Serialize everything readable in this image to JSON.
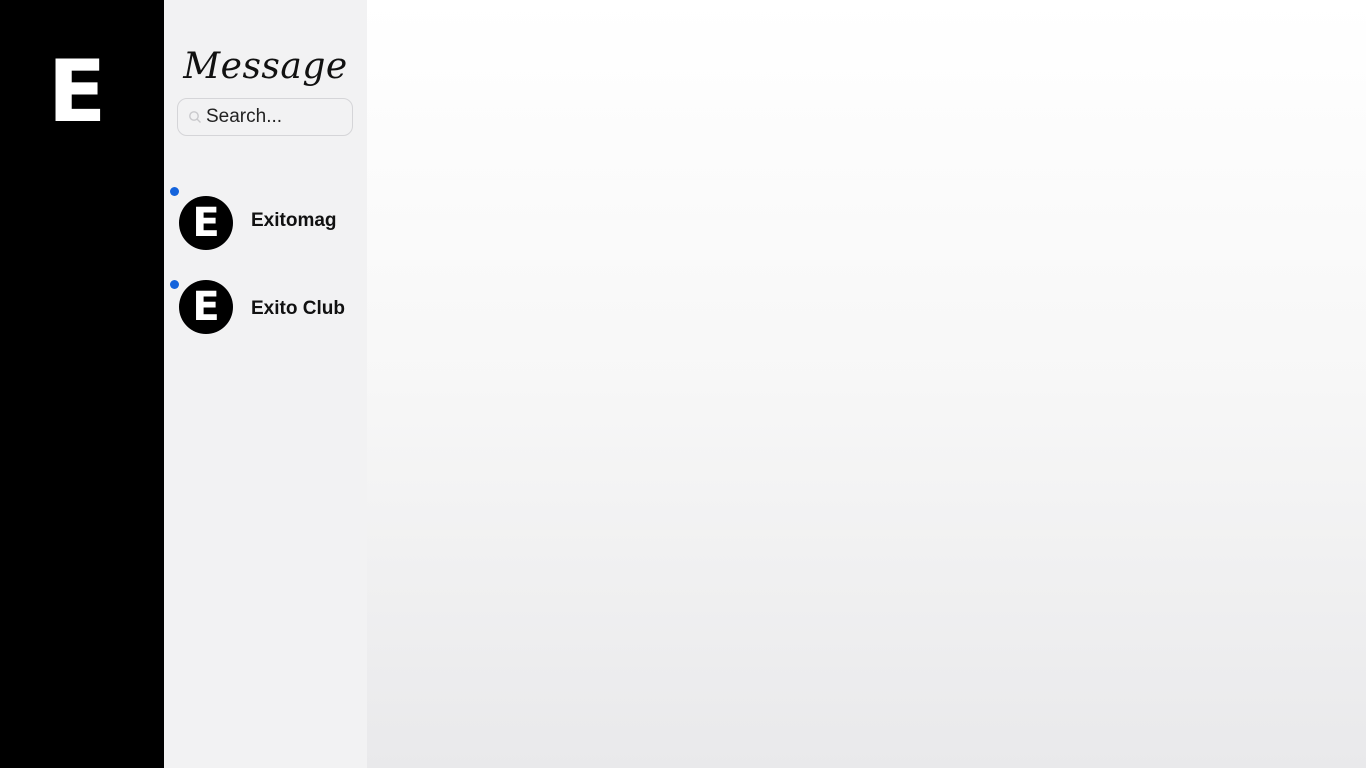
{
  "rail": {
    "logo_letter": "E"
  },
  "sidebar": {
    "title": "Message",
    "search": {
      "placeholder": "Search..."
    },
    "conversations": [
      {
        "name": "Exitomag",
        "avatar_letter": "E",
        "unread": true
      },
      {
        "name": "Exito Club",
        "avatar_letter": "E",
        "unread": true
      }
    ]
  },
  "colors": {
    "rail_bg": "#000000",
    "sidebar_bg": "#f2f2f3",
    "unread_dot": "#1463dc"
  },
  "icons": {
    "search": "search-icon"
  }
}
